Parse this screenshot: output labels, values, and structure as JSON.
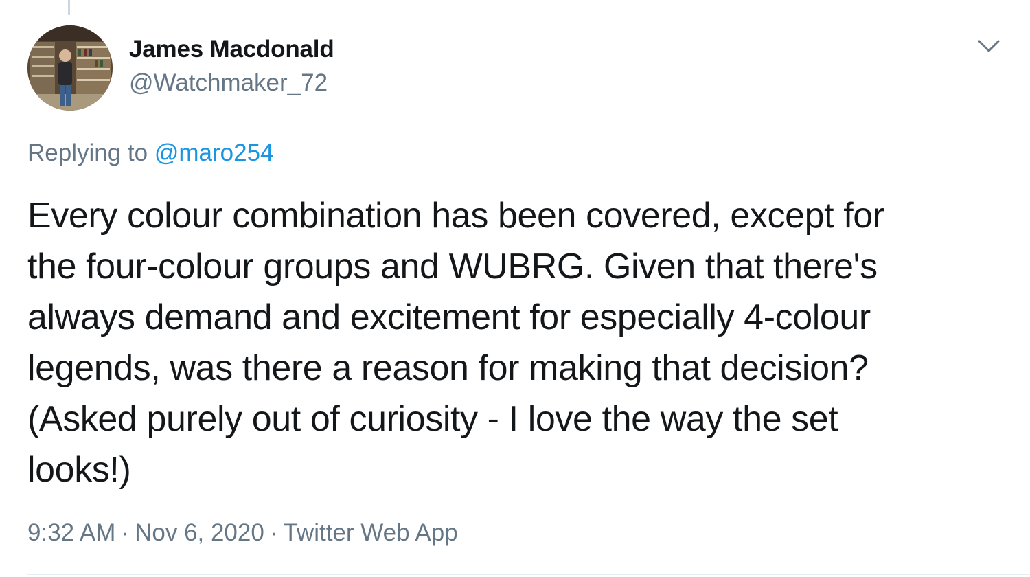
{
  "tweet": {
    "author": {
      "display_name": "James Macdonald",
      "handle": "@Watchmaker_72"
    },
    "reply": {
      "prefix": "Replying to ",
      "mention": "@maro254"
    },
    "text": "Every colour combination has been covered, except for\nthe four-colour groups and WUBRG. Given that there's\nalways demand and excitement for especially 4-colour\nlegends, was there a reason for making that decision?\n(Asked purely out of curiosity - I love the way the set\nlooks!)",
    "meta": {
      "time": "9:32 AM",
      "separator": "·",
      "date": "Nov 6, 2020",
      "source": "Twitter Web App"
    }
  },
  "colors": {
    "text_primary": "#14171a",
    "text_secondary": "#657786",
    "link": "#1b95e0",
    "divider": "#e6ecf0"
  },
  "icons": {
    "more_menu": "chevron-down-icon"
  }
}
